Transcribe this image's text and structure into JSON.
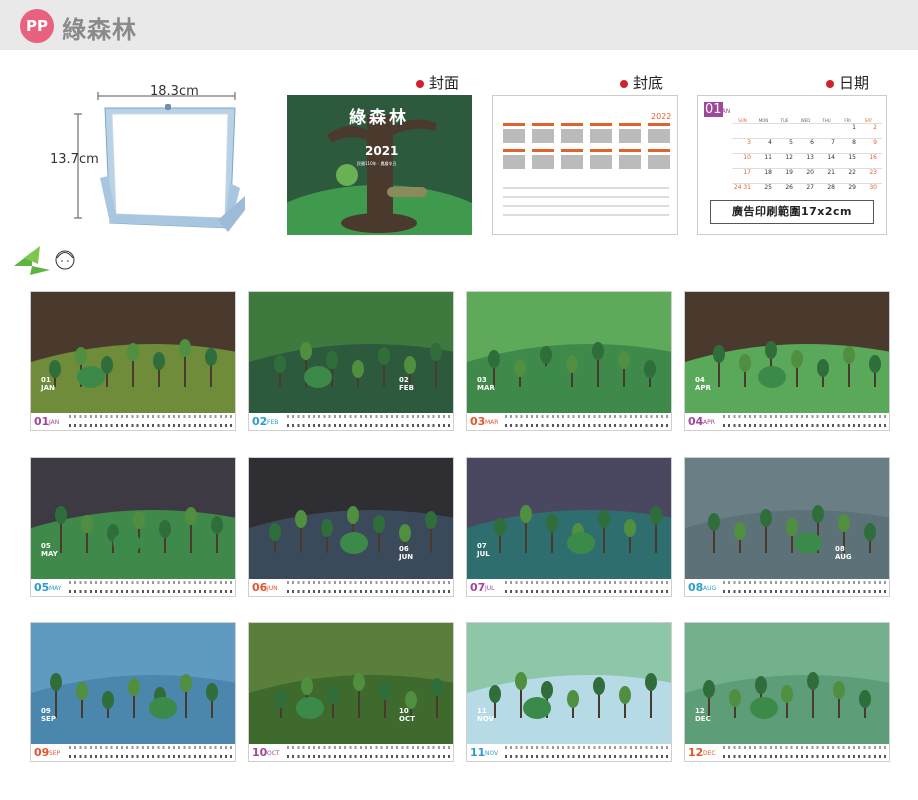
{
  "header": {
    "badge": "PP",
    "title": "綠森林"
  },
  "stand": {
    "width_label": "18.3cm",
    "height_label": "13.7cm"
  },
  "sections": {
    "cover": "封面",
    "back": "封底",
    "date": "日期"
  },
  "cover": {
    "brand": "綠森林",
    "year": "2021",
    "sub": "民國110年 · 農曆辛丑"
  },
  "back": {
    "year": "2022"
  },
  "date_page": {
    "month_num": "01",
    "month_abbr": "JAN",
    "weekdays": [
      "SUN",
      "MON",
      "TUE",
      "WED",
      "THU",
      "FRI",
      "SAT"
    ],
    "days": [
      [
        "",
        "",
        "",
        "",
        "",
        "1",
        "2"
      ],
      [
        "3",
        "4",
        "5",
        "6",
        "7",
        "8",
        "9"
      ],
      [
        "10",
        "11",
        "12",
        "13",
        "14",
        "15",
        "16"
      ],
      [
        "17",
        "18",
        "19",
        "20",
        "21",
        "22",
        "23"
      ],
      [
        "24 31",
        "25",
        "26",
        "27",
        "28",
        "29",
        "30"
      ]
    ],
    "ad_text": "廣告印刷範圍17x2cm"
  },
  "months": [
    {
      "num": "01",
      "abbr": "JAN",
      "color": "#a0479b"
    },
    {
      "num": "02",
      "abbr": "FEB",
      "color": "#2c9ccf"
    },
    {
      "num": "03",
      "abbr": "MAR",
      "color": "#e2562d"
    },
    {
      "num": "04",
      "abbr": "APR",
      "color": "#a0479b"
    },
    {
      "num": "05",
      "abbr": "MAY",
      "color": "#2c9ccf"
    },
    {
      "num": "06",
      "abbr": "JUN",
      "color": "#e2562d"
    },
    {
      "num": "07",
      "abbr": "JUL",
      "color": "#a0479b"
    },
    {
      "num": "08",
      "abbr": "AUG",
      "color": "#2c9ccf"
    },
    {
      "num": "09",
      "abbr": "SEP",
      "color": "#e2562d"
    },
    {
      "num": "10",
      "abbr": "OCT",
      "color": "#a0479b"
    },
    {
      "num": "11",
      "abbr": "NOV",
      "color": "#2c9ccf"
    },
    {
      "num": "12",
      "abbr": "DEC",
      "color": "#e2562d"
    }
  ],
  "art_labels": [
    {
      "num": "01",
      "abbr": "JAN"
    },
    {
      "num": "02",
      "abbr": "FEB"
    },
    {
      "num": "03",
      "abbr": "MAR"
    },
    {
      "num": "04",
      "abbr": "APR"
    },
    {
      "num": "05",
      "abbr": "MAY"
    },
    {
      "num": "06",
      "abbr": "JUN"
    },
    {
      "num": "07",
      "abbr": "JUL"
    },
    {
      "num": "08",
      "abbr": "AUG"
    },
    {
      "num": "09",
      "abbr": "SEP"
    },
    {
      "num": "10",
      "abbr": "OCT"
    },
    {
      "num": "11",
      "abbr": "NOV"
    },
    {
      "num": "12",
      "abbr": "DEC"
    }
  ],
  "colors": {
    "header_bg": "#e9e9ea",
    "badge": "#e8617e",
    "dot": "#d3202e",
    "forest_green": "#2d5a3d"
  }
}
